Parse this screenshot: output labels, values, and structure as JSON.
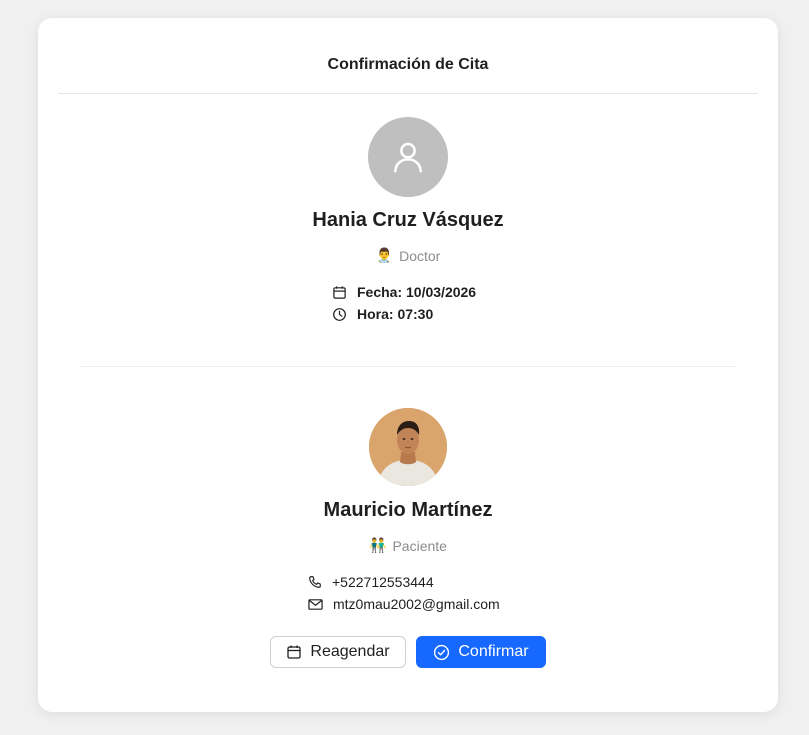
{
  "card": {
    "title": "Confirmación de Cita"
  },
  "doctor": {
    "name": "Hania Cruz Vásquez",
    "role_emoji": "👨‍⚕️",
    "role": "Doctor",
    "date_label": "Fecha: 10/03/2026",
    "time_label": "Hora: 07:30",
    "avatar_icon": "user-icon",
    "avatar_color": "#bfbfbf"
  },
  "patient": {
    "name": "Mauricio Martínez",
    "role_emoji": "👬",
    "role": "Paciente",
    "phone": "+522712553444",
    "email": "mtz0mau2002@gmail.com"
  },
  "actions": {
    "reschedule_label": "Reagendar",
    "confirm_label": "Confirmar"
  },
  "colors": {
    "primary": "#1668ff",
    "muted_text": "#8c8c8c"
  }
}
